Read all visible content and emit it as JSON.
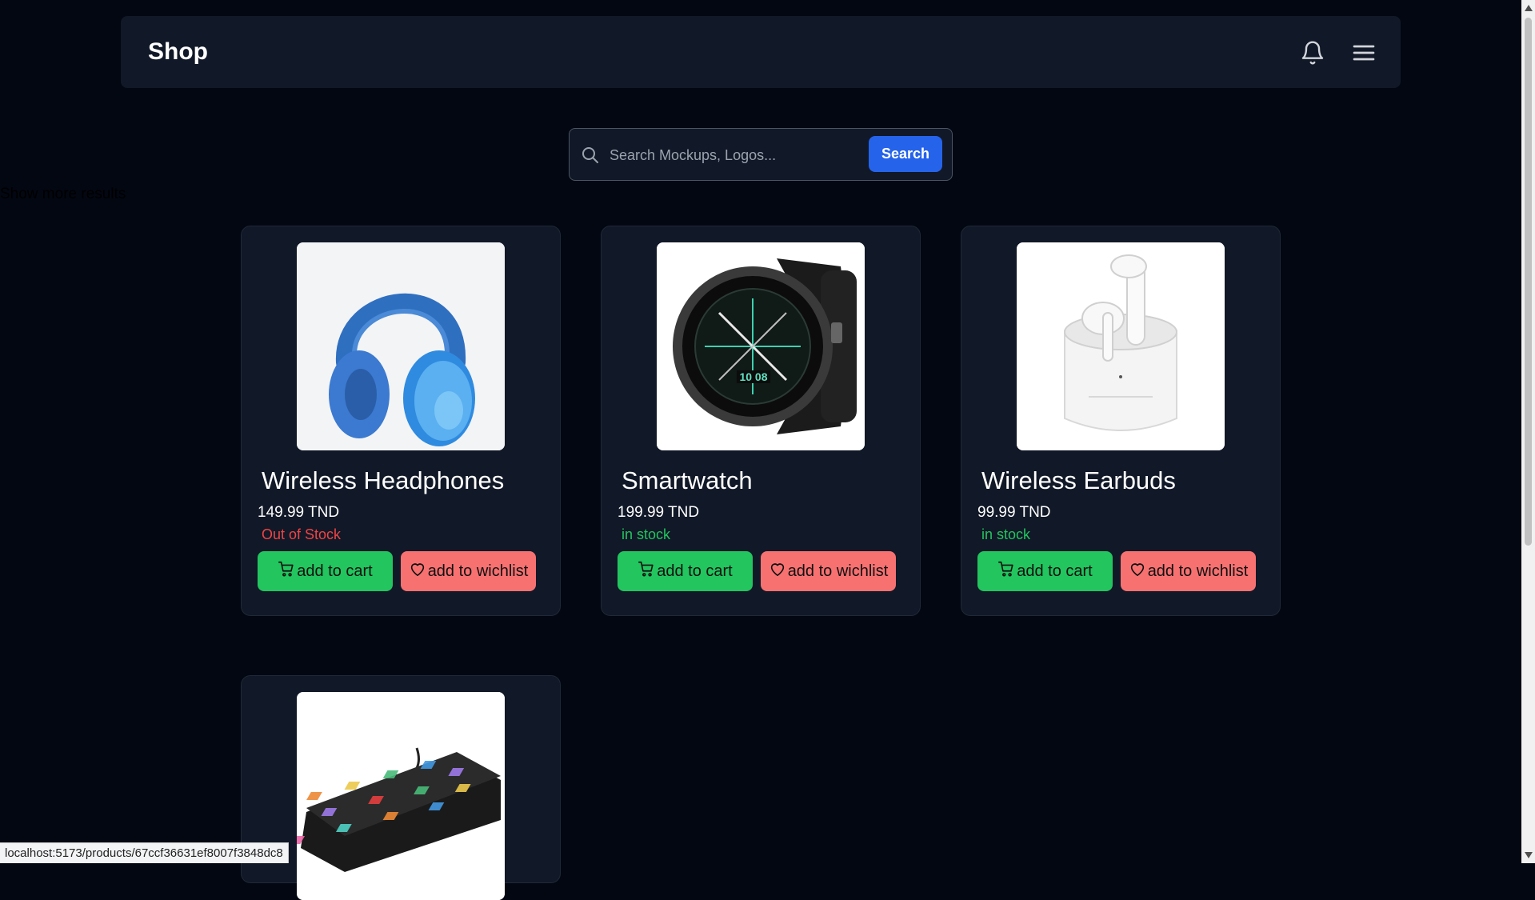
{
  "navbar": {
    "brand": "Shop",
    "bell_icon": "bell-icon",
    "menu_icon": "hamburger-menu-icon"
  },
  "search": {
    "placeholder": "Search Mockups, Logos...",
    "value": "",
    "button_label": "Search",
    "icon": "search-icon"
  },
  "show_more": "Show more results",
  "colors": {
    "background": "#030712",
    "card": "#111827",
    "accent": "#2563eb",
    "cart_button": "#22c55e",
    "wishlist_button": "#f87171",
    "out_of_stock": "#ef4444",
    "in_stock": "#22c55e"
  },
  "products": [
    {
      "name": "Wireless Headphones",
      "price": "149.99 TND",
      "stock": "Out of Stock",
      "image": "headphones-image",
      "cart_label": "add to cart",
      "wishlist_label": "add to wichlist"
    },
    {
      "name": "Smartwatch",
      "price": "199.99 TND",
      "stock": "in stock",
      "image": "smartwatch-image",
      "cart_label": "add to cart",
      "wishlist_label": "add to wichlist"
    },
    {
      "name": "Wireless Earbuds",
      "price": "99.99 TND",
      "stock": "in stock",
      "image": "earbuds-image",
      "cart_label": "add to cart",
      "wishlist_label": "add to wichlist"
    },
    {
      "name": "",
      "image": "keyboard-image"
    }
  ],
  "status_bar": {
    "url": "localhost:5173/products/67ccf36631ef8007f3848dc8"
  }
}
